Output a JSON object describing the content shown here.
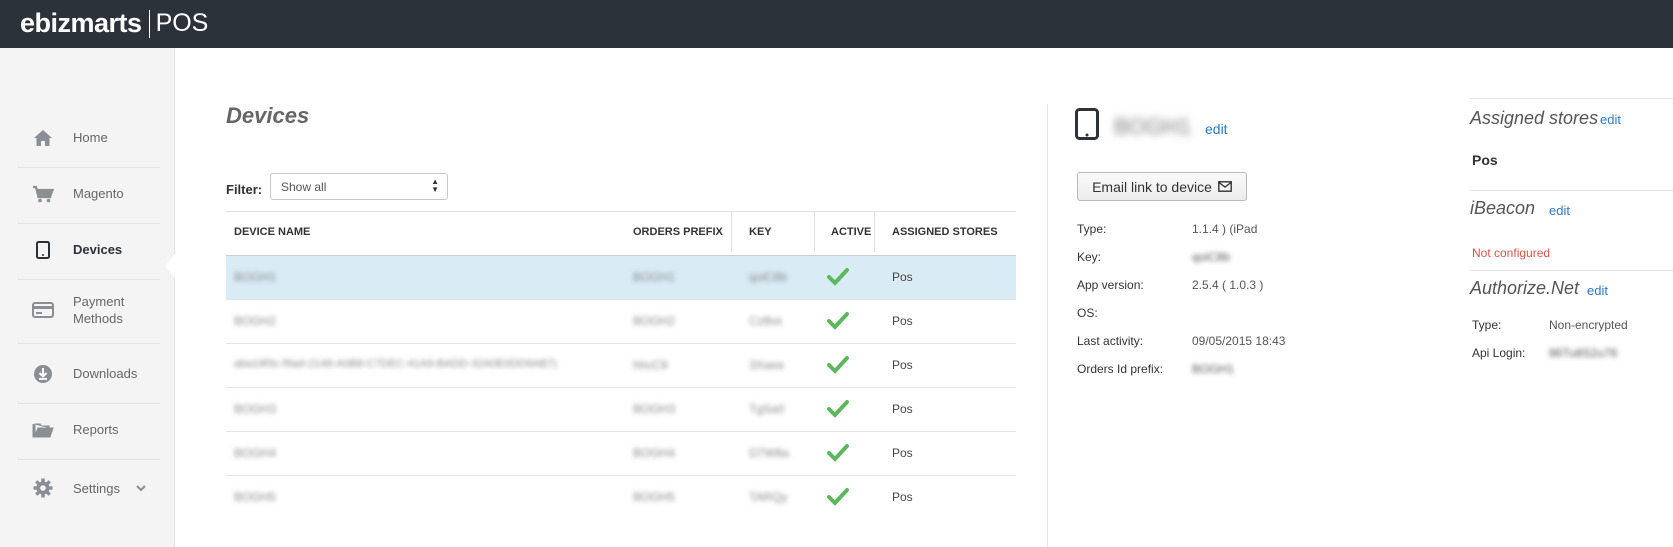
{
  "brand": {
    "name": "ebizmarts",
    "product": "POS"
  },
  "sidebar": {
    "items": [
      {
        "label": "Home",
        "icon": "home-icon"
      },
      {
        "label": "Magento",
        "icon": "cart-icon"
      },
      {
        "label": "Devices",
        "icon": "tablet-icon",
        "active": true
      },
      {
        "label": "Payment Methods",
        "icon": "credit-card-icon"
      },
      {
        "label": "Downloads",
        "icon": "download-icon"
      },
      {
        "label": "Reports",
        "icon": "folder-icon"
      },
      {
        "label": "Settings",
        "icon": "gear-icon"
      }
    ]
  },
  "page": {
    "title": "Devices"
  },
  "filter": {
    "label": "Filter:",
    "value": "Show all"
  },
  "table": {
    "columns": [
      "DEVICE NAME",
      "ORDERS PREFIX",
      "KEY",
      "ACTIVE",
      "ASSIGNED STORES"
    ],
    "rows": [
      {
        "device_name": "BOGH1",
        "orders_prefix": "BOGH1",
        "key": "qoiC8b",
        "active": true,
        "stores": "Pos"
      },
      {
        "device_name": "BOGH2",
        "orders_prefix": "BOGH2",
        "key": "CzBot",
        "active": true,
        "stores": "Pos"
      },
      {
        "device_name": "aba19f3c-f9ad-2148-A0B8-C7DEC-41A9-BADD-32A0E0DD9AB7)",
        "orders_prefix": "hhcC9",
        "key": "3Xaea",
        "active": true,
        "stores": "Pos"
      },
      {
        "device_name": "BOGH3",
        "orders_prefix": "BOGH3",
        "key": "TgSa0",
        "active": true,
        "stores": "Pos"
      },
      {
        "device_name": "BOGH4",
        "orders_prefix": "BOGH4",
        "key": "D7W8a",
        "active": true,
        "stores": "Pos"
      },
      {
        "device_name": "BOGH5",
        "orders_prefix": "BOGH5",
        "key": "TARQy",
        "active": true,
        "stores": "Pos"
      }
    ]
  },
  "device": {
    "name": "BOGH1",
    "edit_label": "edit",
    "email_button_label": "Email link to device",
    "fields": [
      {
        "label": "Type:",
        "value": "1.1.4 ) (iPad"
      },
      {
        "label": "Key:",
        "value": "qoiC8b"
      },
      {
        "label": "App version:",
        "value": "2.5.4 ( 1.0.3 )"
      },
      {
        "label": "OS:",
        "value": ""
      },
      {
        "label": "Last activity:",
        "value": "09/05/2015 18:43"
      },
      {
        "label": "Orders Id prefix:",
        "value": "BOGH1"
      }
    ]
  },
  "assigned_stores": {
    "title": "Assigned stores",
    "edit_label": "edit",
    "value": "Pos"
  },
  "ibeacon": {
    "title": "iBeacon",
    "edit_label": "edit",
    "status": "Not configured"
  },
  "authorize_net": {
    "title": "Authorize.Net",
    "edit_label": "edit",
    "fields": [
      {
        "label": "Type:",
        "value": "Non-encrypted"
      },
      {
        "label": "Api Login:",
        "value": "86Tu8S2u76"
      }
    ]
  },
  "colors": {
    "topbar": "#2b323a",
    "accent": "#2a7ac7",
    "selected_row": "#d9ebf4",
    "check": "#5cb85c",
    "error": "#d9534f"
  }
}
